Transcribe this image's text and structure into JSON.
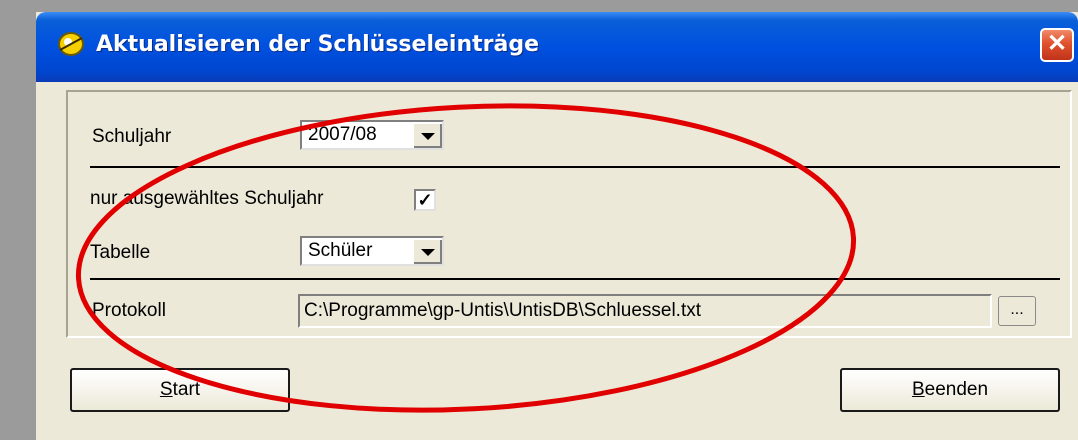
{
  "window": {
    "title": "Aktualisieren der Schlüsseleinträge",
    "close_glyph": "✕"
  },
  "form": {
    "schuljahr_label": "Schuljahr",
    "schuljahr_value": "2007/08",
    "checkbox_label": "nur ausgewähltes Schuljahr",
    "checkbox_checked": true,
    "checkbox_mark": "✓",
    "tabelle_label": "Tabelle",
    "tabelle_value": "Schüler",
    "protokoll_label": "Protokoll",
    "protokoll_value": "C:\\Programme\\gp-Untis\\UntisDB\\Schluessel.txt",
    "browse_label": "..."
  },
  "buttons": {
    "start_underlined": "S",
    "start_rest": "tart",
    "beenden_underlined": "B",
    "beenden_rest": "eenden"
  },
  "annotation": {
    "color": "#e00000",
    "shape": "ellipse"
  },
  "colors": {
    "title_bar": "#0050e0",
    "dialog_face": "#ece9d8",
    "close_button": "#e0512c"
  },
  "icons": {
    "app": "app-icon",
    "close": "close-icon",
    "dropdown": "chevron-down-icon",
    "check": "check-icon"
  }
}
